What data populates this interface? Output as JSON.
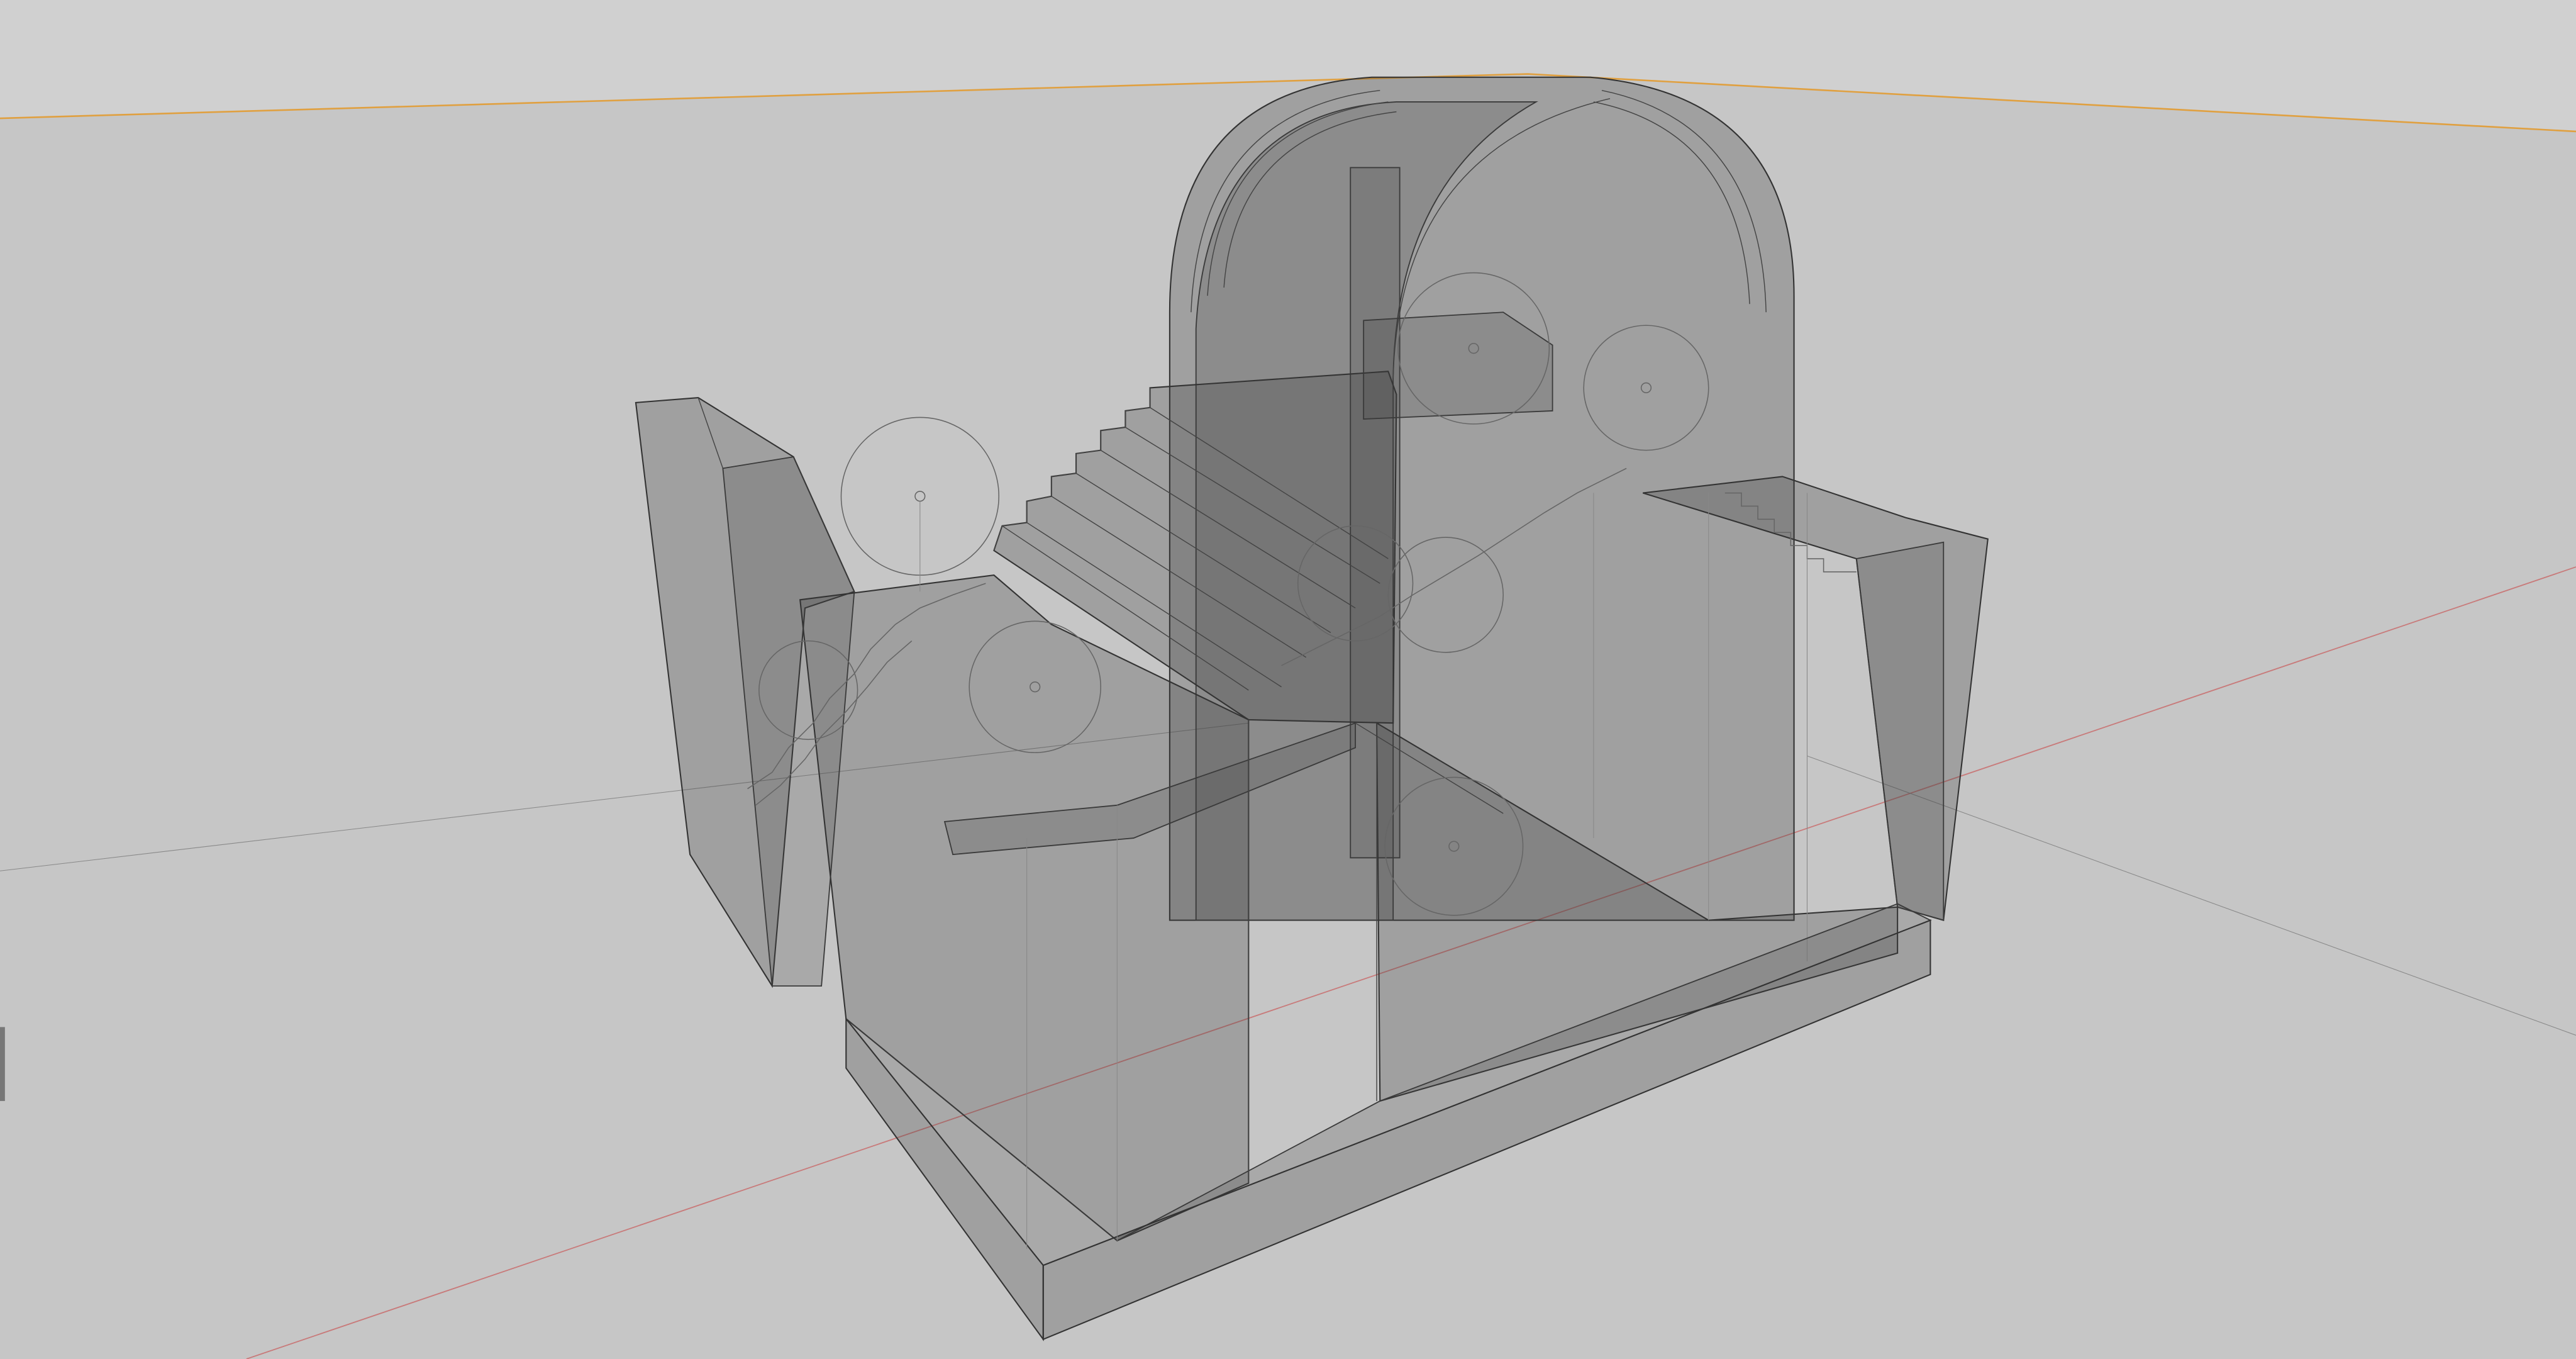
{
  "viewport": {
    "colors": {
      "background_sky": "#d0d0d0",
      "background_floor": "#c6c6c6",
      "horizon_line": "#e0a040",
      "x_axis": "#c87a7a",
      "mesh_fill": "#555555",
      "mesh_edge": "#333333"
    },
    "light_gizmos": 8
  }
}
